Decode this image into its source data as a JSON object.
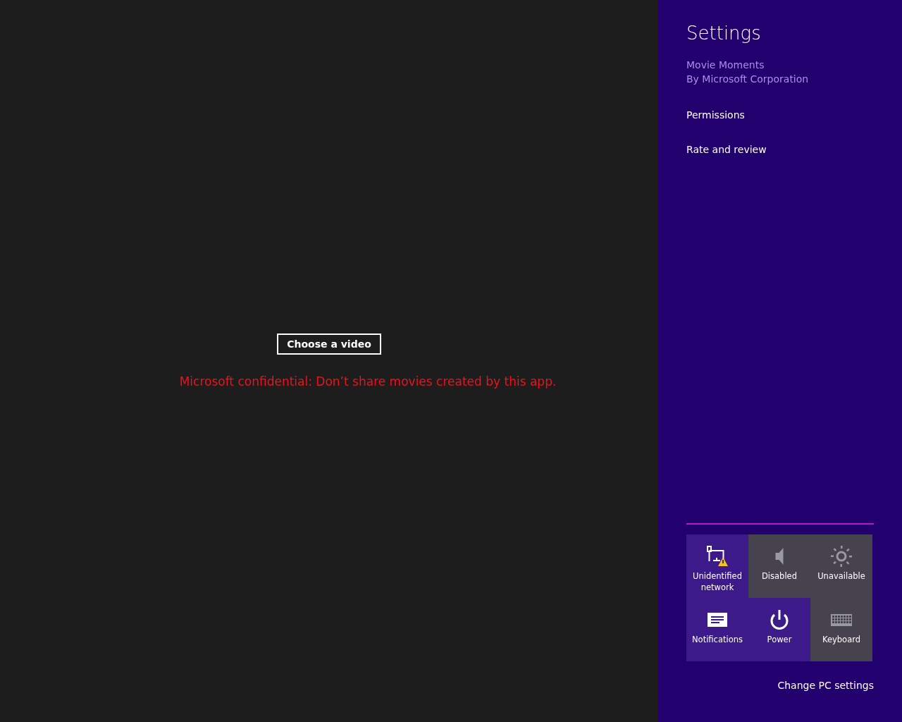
{
  "app": {
    "choose_button": "Choose a video",
    "notice": "Microsoft confidential: Don’t share movies created by this app."
  },
  "settings_pane": {
    "title": "Settings",
    "app_name": "Movie Moments",
    "publisher": "By Microsoft Corporation",
    "links": [
      "Permissions",
      "Rate and review"
    ],
    "tiles": [
      {
        "kind": "network",
        "label": "Unidentified network",
        "disabled": false
      },
      {
        "kind": "volume",
        "label": "Disabled",
        "disabled": true
      },
      {
        "kind": "brightness",
        "label": "Unavailable",
        "disabled": true
      },
      {
        "kind": "notifications",
        "label": "Notifications",
        "disabled": false
      },
      {
        "kind": "power",
        "label": "Power",
        "disabled": false
      },
      {
        "kind": "keyboard",
        "label": "Keyboard",
        "disabled": true
      }
    ],
    "footer_link": "Change PC settings"
  }
}
